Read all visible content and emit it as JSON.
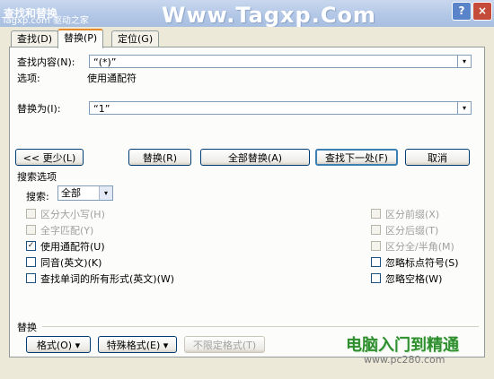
{
  "window": {
    "title": "查找和替换",
    "watermark_top_left": "Tagxp.com 驱动之家",
    "watermark_top_right": "Www.Tagxp.Com",
    "help_label": "?",
    "close_label": "×"
  },
  "tabs": [
    {
      "label": "查找(D)",
      "active": false
    },
    {
      "label": "替换(P)",
      "active": true
    },
    {
      "label": "定位(G)",
      "active": false
    }
  ],
  "find": {
    "label": "查找内容(N):",
    "value": "“(*)”",
    "options_label": "选项:",
    "options_value": "使用通配符"
  },
  "replace": {
    "label": "替换为(I):",
    "value": "“1”"
  },
  "buttons": {
    "less": "<< 更少(L)",
    "replace": "替换(R)",
    "replace_all": "全部替换(A)",
    "find_next": "查找下一处(F)",
    "cancel": "取消"
  },
  "search_options": {
    "title": "搜索选项",
    "search_label": "搜索:",
    "search_value": "全部",
    "left_checks": [
      {
        "label": "区分大小写(H)",
        "checked": false,
        "disabled": true
      },
      {
        "label": "全字匹配(Y)",
        "checked": false,
        "disabled": true
      },
      {
        "label": "使用通配符(U)",
        "checked": true,
        "disabled": false
      },
      {
        "label": "同音(英文)(K)",
        "checked": false,
        "disabled": false
      },
      {
        "label": "查找单词的所有形式(英文)(W)",
        "checked": false,
        "disabled": false
      }
    ],
    "right_checks": [
      {
        "label": "区分前缀(X)",
        "checked": false,
        "disabled": true
      },
      {
        "label": "区分后缀(T)",
        "checked": false,
        "disabled": true
      },
      {
        "label": "区分全/半角(M)",
        "checked": false,
        "disabled": true
      },
      {
        "label": "忽略标点符号(S)",
        "checked": false,
        "disabled": false
      },
      {
        "label": "忽略空格(W)",
        "checked": false,
        "disabled": false
      }
    ]
  },
  "replace_section": {
    "title": "替换",
    "format_btn": "格式(O) ▾",
    "special_btn": "特殊格式(E) ▾",
    "no_format_btn": "不限定格式(T)"
  },
  "watermarks": {
    "logo": "电脑入门到精通",
    "url": "www.pc280.com"
  },
  "icons": {
    "dropdown": "▾",
    "check": "✓"
  }
}
